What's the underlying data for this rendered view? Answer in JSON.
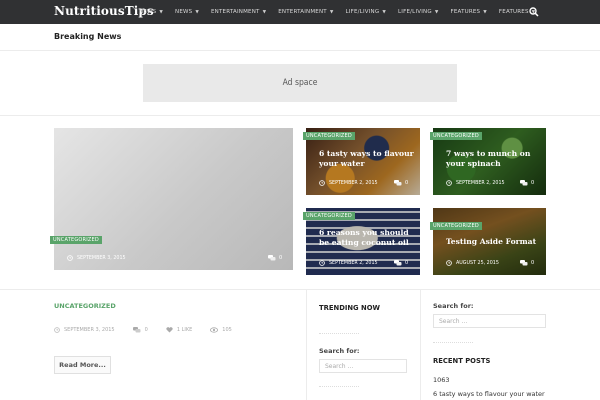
{
  "header": {
    "logo": "NutritiousTips",
    "nav": [
      "NEWS",
      "NEWS",
      "ENTERTAINMENT",
      "ENTERTAINMENT",
      "LIFE/LIVING",
      "LIFE/LIVING",
      "FEATURES",
      "FEATURES"
    ],
    "search_icon": "search-icon"
  },
  "breaking": {
    "label": "Breaking News"
  },
  "ad": {
    "label": "Ad space"
  },
  "featured": {
    "big": {
      "category": "UNCATEGORIZED",
      "date": "SEPTEMBER 3, 2015",
      "comments": "0"
    },
    "tiles": [
      {
        "category": "UNCATEGORIZED",
        "title_line1": "6 tasty ways to flavour",
        "title_line2": "your water",
        "date": "SEPTEMBER 2, 2015",
        "comments": "0"
      },
      {
        "category": "UNCATEGORIZED",
        "title_line1": "7 ways to munch on",
        "title_line2": "your spinach",
        "date": "SEPTEMBER 2, 2015",
        "comments": "0"
      },
      {
        "category": "UNCATEGORIZED",
        "title_line1": "6 reasons you should",
        "title_line2": "be eating coconut oil",
        "date": "SEPTEMBER 2, 2015",
        "comments": "0"
      },
      {
        "category": "UNCATEGORIZED",
        "title_line1": "Testing Aside Format",
        "title_line2": "",
        "date": "AUGUST 25, 2015",
        "comments": "0"
      }
    ]
  },
  "post": {
    "category": "UNCATEGORIZED",
    "date": "SEPTEMBER 3, 2015",
    "comments": "0",
    "likes": "1 LIKE",
    "views": "105",
    "read_more": "Read More..."
  },
  "sidebar_mid": {
    "trending": "TRENDING NOW",
    "search_label": "Search for:",
    "search_placeholder": "Search ..."
  },
  "sidebar_right": {
    "search_label": "Search for:",
    "search_placeholder": "Search ...",
    "recent_head": "RECENT POSTS",
    "recent": [
      "1063",
      "6 tasty ways to flavour your water"
    ]
  },
  "colors": {
    "accent": "#5aa46a",
    "topbar": "#303133"
  }
}
